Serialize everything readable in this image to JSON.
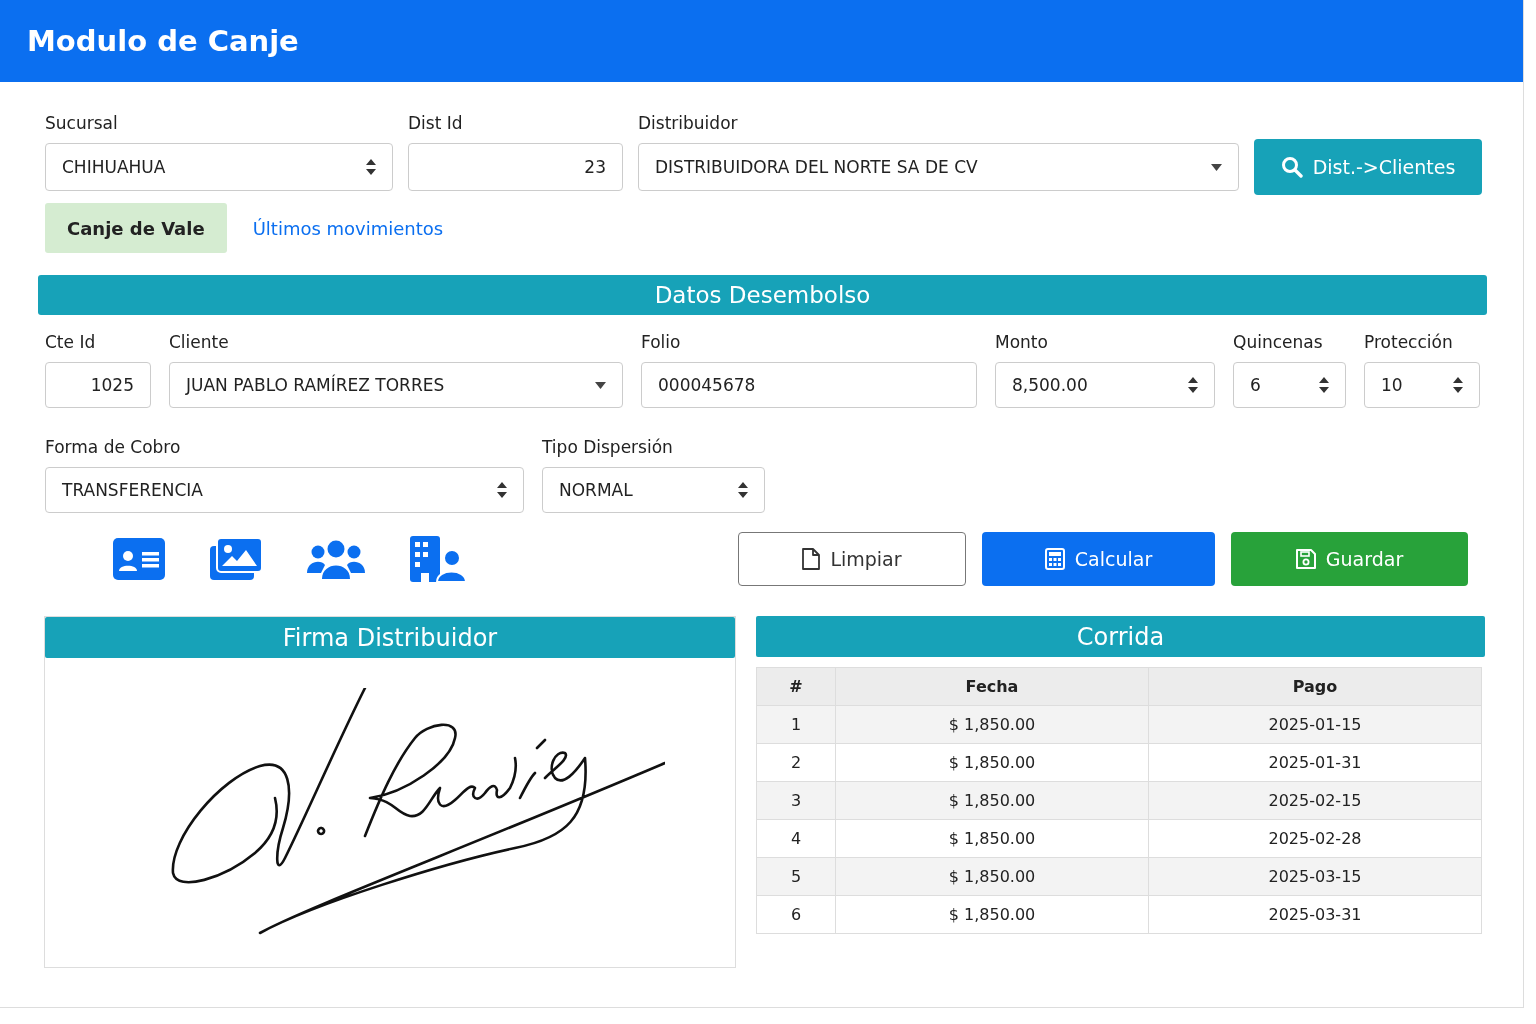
{
  "header": {
    "title": "Modulo de Canje"
  },
  "distributor_fields": [
    {
      "label": "Sucursal",
      "value": "CHIHUAHUA",
      "kind": "spinner"
    },
    {
      "label": "Dist Id",
      "value": "23",
      "kind": "number"
    },
    {
      "label": "Distribuidor",
      "value": "DISTRIBUIDORA DEL NORTE SA DE CV",
      "kind": "select"
    }
  ],
  "search_button": {
    "label": "Dist.->Clientes"
  },
  "tabs": [
    {
      "label": "Canje de Vale",
      "selected": true
    },
    {
      "label": "Últimos movimientos",
      "selected": false
    }
  ],
  "disbursement": {
    "title": "Datos Desembolso",
    "fields": [
      {
        "label": "Cte Id",
        "value": "1025",
        "kind": "number"
      },
      {
        "label": "Cliente",
        "value": "JUAN PABLO RAMÍREZ TORRES",
        "kind": "select"
      },
      {
        "label": "Folio",
        "value": "000045678",
        "kind": "text"
      },
      {
        "label": "Monto",
        "value": "8,500.00",
        "kind": "spinner"
      },
      {
        "label": "Quincenas",
        "value": "6",
        "kind": "spinner"
      },
      {
        "label": "Protección",
        "value": "10",
        "kind": "spinner"
      }
    ],
    "payment_fields": [
      {
        "label": "Forma de Cobro",
        "value": "TRANSFERENCIA",
        "kind": "spinner"
      },
      {
        "label": "Tipo Dispersión",
        "value": "NORMAL",
        "kind": "spinner"
      }
    ]
  },
  "buttons": [
    {
      "label": "Limpiar",
      "kind": "clear"
    },
    {
      "label": "Calcular",
      "kind": "calculate"
    },
    {
      "label": "Guardar",
      "kind": "save"
    }
  ],
  "signature_panel": {
    "title": "Firma Distribuidor"
  },
  "schedule": {
    "title": "Corrida",
    "columns": [
      "#",
      "Fecha",
      "Pago"
    ],
    "rows": [
      [
        "1",
        "$ 1,850.00",
        "2025-01-15"
      ],
      [
        "2",
        "$ 1,850.00",
        "2025-01-31"
      ],
      [
        "3",
        "$ 1,850.00",
        "2025-02-15"
      ],
      [
        "4",
        "$ 1,850.00",
        "2025-02-28"
      ],
      [
        "5",
        "$ 1,850.00",
        "2025-03-15"
      ],
      [
        "6",
        "$ 1,850.00",
        "2025-03-31"
      ]
    ]
  }
}
